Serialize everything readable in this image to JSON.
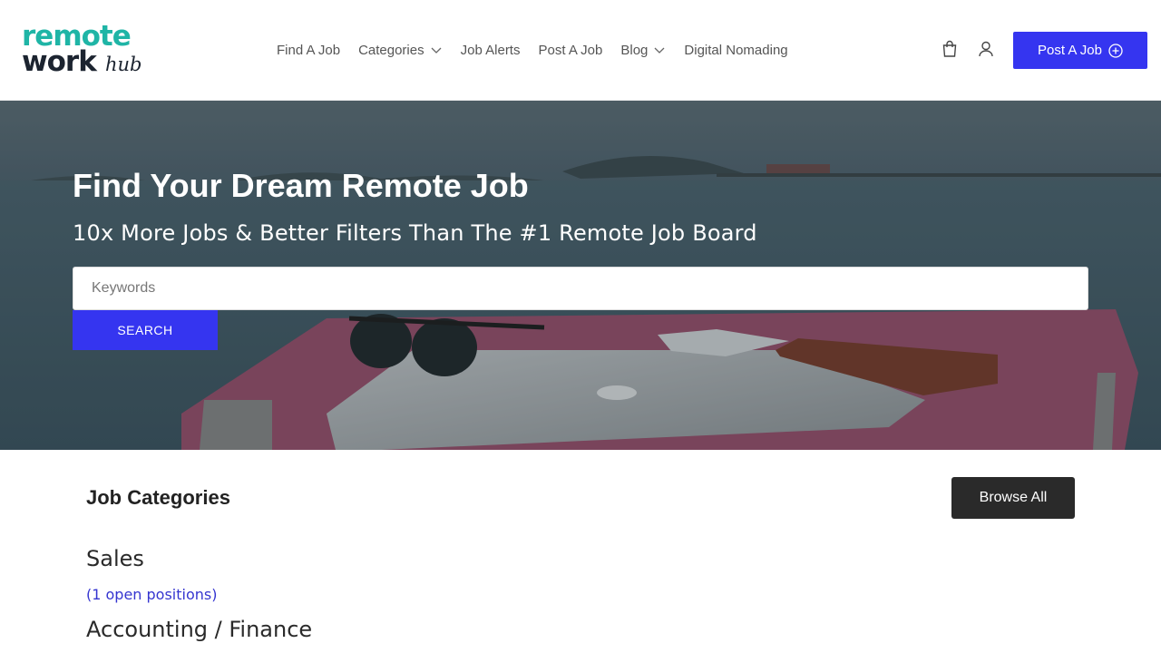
{
  "brand": {
    "logo_line1": "remote",
    "logo_line2": "work",
    "logo_script": "hub",
    "accent_color": "#1fb5a6",
    "dark_color": "#1c2430"
  },
  "nav": {
    "items": [
      {
        "label": "Find A Job",
        "has_dropdown": false
      },
      {
        "label": "Categories",
        "has_dropdown": true
      },
      {
        "label": "Job Alerts",
        "has_dropdown": false
      },
      {
        "label": "Post A Job",
        "has_dropdown": false
      },
      {
        "label": "Blog",
        "has_dropdown": true
      },
      {
        "label": "Digital Nomading",
        "has_dropdown": false
      }
    ],
    "cart_icon": "shopping-bag-icon",
    "account_icon": "user-icon",
    "cta_label": "Post A Job",
    "cta_icon": "plus-circle-icon",
    "cta_color": "#3535f0"
  },
  "hero": {
    "title": "Find Your Dream Remote Job",
    "subtitle": "10x More Jobs & Better Filters Than The #1 Remote Job Board",
    "search_placeholder": "Keywords",
    "search_value": "",
    "search_button": "SEARCH"
  },
  "categories": {
    "heading": "Job Categories",
    "browse_label": "Browse All",
    "items": [
      {
        "name": "Sales",
        "count_text": "(1 open positions)"
      },
      {
        "name": "Accounting / Finance",
        "count_text": ""
      }
    ]
  }
}
